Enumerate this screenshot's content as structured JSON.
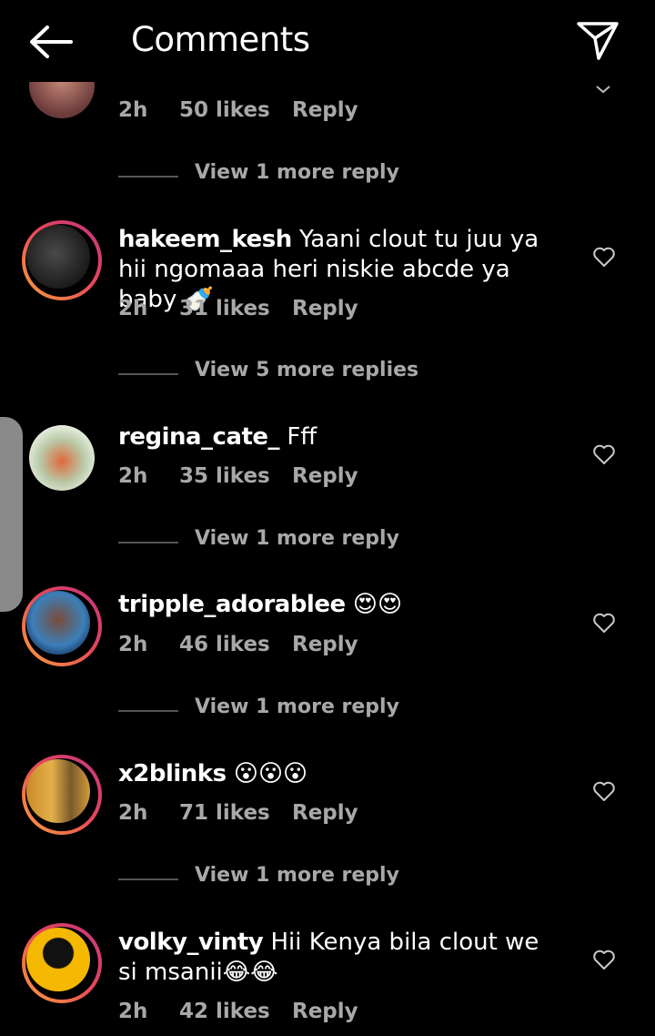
{
  "header": {
    "title": "Comments"
  },
  "top_partial_comment": {
    "time": "2h",
    "likes": "50 likes",
    "reply": "Reply",
    "view_more": "View 1 more reply"
  },
  "comments": [
    {
      "username": "hakeem_kesh",
      "text": "Yaani clout tu juu ya hii ngomaaa heri niskie abcde ya baby",
      "emoji": "🍼",
      "time": "2h",
      "likes": "31 likes",
      "reply": "Reply",
      "view_more": "View 5 more replies"
    },
    {
      "username": "regina_cate_",
      "text": "Fff",
      "emoji": "",
      "time": "2h",
      "likes": "35 likes",
      "reply": "Reply",
      "view_more": "View 1 more reply"
    },
    {
      "username": "tripple_adorablee",
      "text": "",
      "emoji": "😍😍",
      "time": "2h",
      "likes": "46 likes",
      "reply": "Reply",
      "view_more": "View 1 more reply"
    },
    {
      "username": "x2blinks",
      "text": "",
      "emoji": "😮😮😮",
      "time": "2h",
      "likes": "71 likes",
      "reply": "Reply",
      "view_more": "View 1 more reply"
    },
    {
      "username": "volky_vinty",
      "text": "Hii Kenya bila clout we si msanii",
      "emoji": "😂😂",
      "time": "2h",
      "likes": "42 likes",
      "reply": "Reply"
    }
  ],
  "icons": {
    "back": "arrow-left-icon",
    "share": "paper-plane-icon",
    "like": "heart-outline-icon",
    "collapse": "chevron-down-icon"
  },
  "colors": {
    "background": "#000000",
    "text": "#ffffff",
    "muted": "#a8a8a8",
    "story_ring_start": "#f9a03c",
    "story_ring_end": "#c13584"
  }
}
